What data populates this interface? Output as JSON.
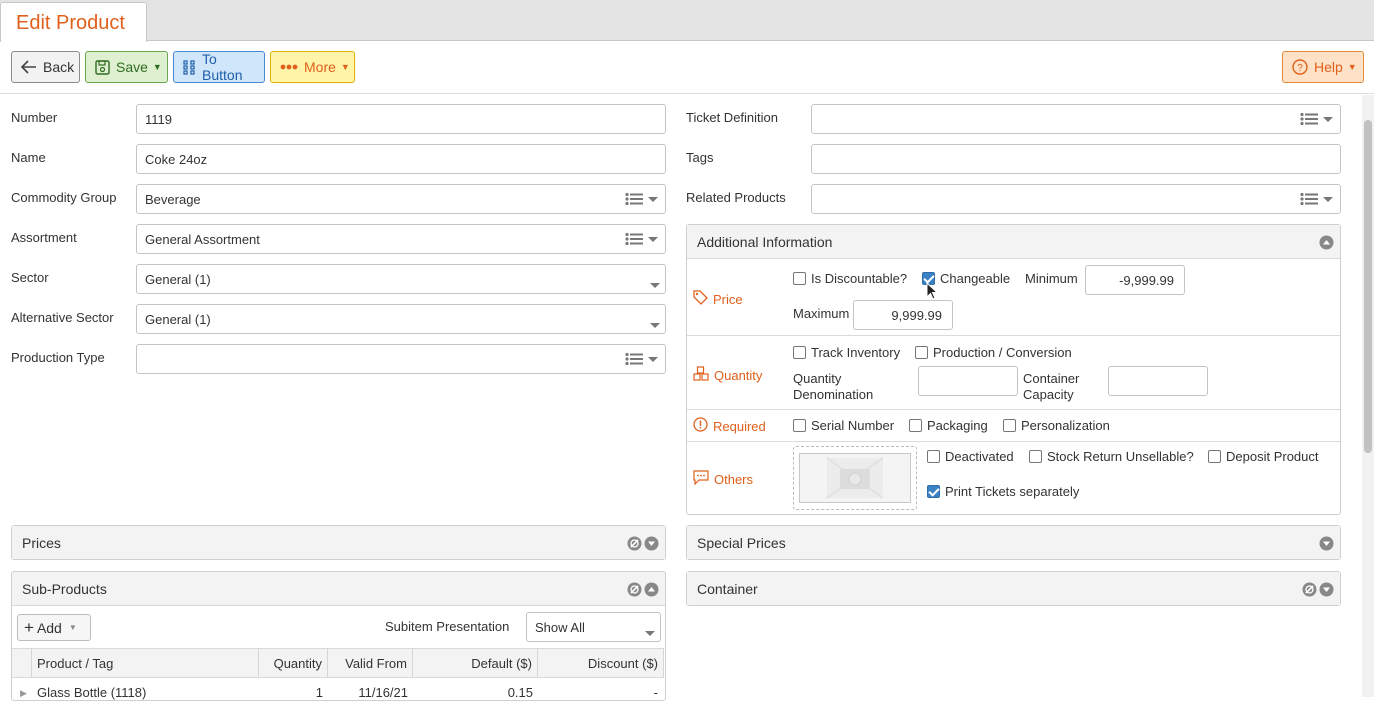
{
  "tab": {
    "title": "Edit Product"
  },
  "toolbar": {
    "back": "Back",
    "save": "Save",
    "to_button": "To Button",
    "more": "More",
    "help": "Help"
  },
  "form_left": [
    {
      "label": "Number",
      "value": "1119",
      "kind": "text"
    },
    {
      "label": "Name",
      "value": "Coke 24oz",
      "kind": "text"
    },
    {
      "label": "Commodity Group",
      "value": "Beverage",
      "kind": "list"
    },
    {
      "label": "Assortment",
      "value": "General Assortment",
      "kind": "list"
    },
    {
      "label": "Sector",
      "value": "General (1)",
      "kind": "select"
    },
    {
      "label": "Alternative Sector",
      "value": "General (1)",
      "kind": "select"
    },
    {
      "label": "Production Type",
      "value": "",
      "kind": "list"
    }
  ],
  "form_right": [
    {
      "label": "Ticket Definition",
      "value": "",
      "kind": "list"
    },
    {
      "label": "Tags",
      "value": "",
      "kind": "text"
    },
    {
      "label": "Related Products",
      "value": "",
      "kind": "list"
    }
  ],
  "additional": {
    "title": "Additional Information",
    "price": {
      "label": "Price",
      "is_discountable": "Is Discountable?",
      "changeable": "Changeable",
      "minimum_label": "Minimum",
      "minimum_value": "-9,999.99",
      "maximum_label": "Maximum",
      "maximum_value": "9,999.99"
    },
    "quantity": {
      "label": "Quantity",
      "track_inventory": "Track Inventory",
      "production": "Production / Conversion",
      "denom_label_1": "Quantity",
      "denom_label_2": "Denomination",
      "capacity_label_1": "Container",
      "capacity_label_2": "Capacity"
    },
    "required": {
      "label": "Required",
      "serial": "Serial Number",
      "packaging": "Packaging",
      "personalization": "Personalization"
    },
    "others": {
      "label": "Others",
      "deactivated": "Deactivated",
      "stock_return": "Stock Return Unsellable?",
      "deposit": "Deposit Product",
      "print_tickets": "Print Tickets separately"
    }
  },
  "panels": {
    "prices": "Prices",
    "special_prices": "Special Prices",
    "sub_products": "Sub-Products",
    "container": "Container"
  },
  "sub_products": {
    "add": "Add",
    "presentation_label": "Subitem Presentation",
    "presentation_value": "Show All",
    "columns": [
      "Product / Tag",
      "Quantity",
      "Valid From",
      "Default ($)",
      "Discount ($)"
    ],
    "rows": [
      {
        "product": "Glass Bottle (1118)",
        "quantity": "1",
        "valid_from": "11/16/21",
        "default": "0.15",
        "discount": "-"
      }
    ]
  },
  "colors": {
    "accent": "#e0601c",
    "check": "#3b82c4"
  }
}
